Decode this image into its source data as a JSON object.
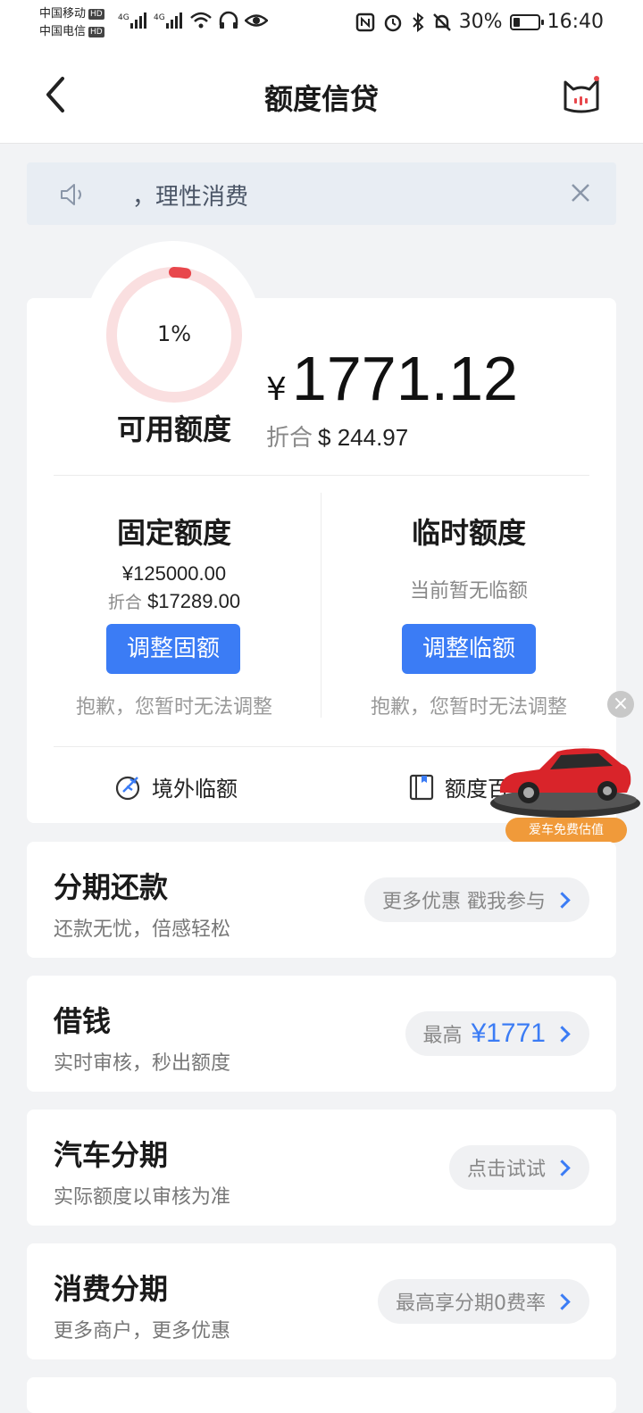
{
  "status_bar": {
    "carrier1": "中国移动",
    "carrier2": "中国电信",
    "hd": "HD",
    "battery": "30%",
    "battery_level": 0.3,
    "time": "16:40"
  },
  "nav": {
    "title": "额度信贷"
  },
  "notice": {
    "text": "，理性消费"
  },
  "credit": {
    "percent_label": "1%",
    "percent": 1,
    "available_label": "可用额度",
    "currency": "¥",
    "amount": "1771.12",
    "conv_label": "折合",
    "conv_amount": "$ 244.97",
    "fixed": {
      "title": "固定额度",
      "amount": "¥125000.00",
      "conv_label": "折合",
      "conv_amount": "$17289.00",
      "button": "调整固额",
      "note": "抱歉，您暂时无法调整"
    },
    "temp": {
      "title": "临时额度",
      "status": "当前暂无临额",
      "button": "调整临额",
      "note": "抱歉，您暂时无法调整"
    },
    "links": {
      "overseas": "境外临额",
      "encyclopedia": "额度百"
    }
  },
  "ad": {
    "text": "爱车免费估值"
  },
  "rows": [
    {
      "title": "分期还款",
      "subtitle": "还款无忧，倍感轻松",
      "pill": "更多优惠 戳我参与"
    },
    {
      "title": "借钱",
      "subtitle": "实时审核，秒出额度",
      "pill_prefix": "最高",
      "pill_value": "¥1771"
    },
    {
      "title": "汽车分期",
      "subtitle": "实际额度以审核为准",
      "pill": "点击试试"
    },
    {
      "title": "消费分期",
      "subtitle": "更多商户，更多优惠",
      "pill": "最高享分期0费率"
    }
  ]
}
